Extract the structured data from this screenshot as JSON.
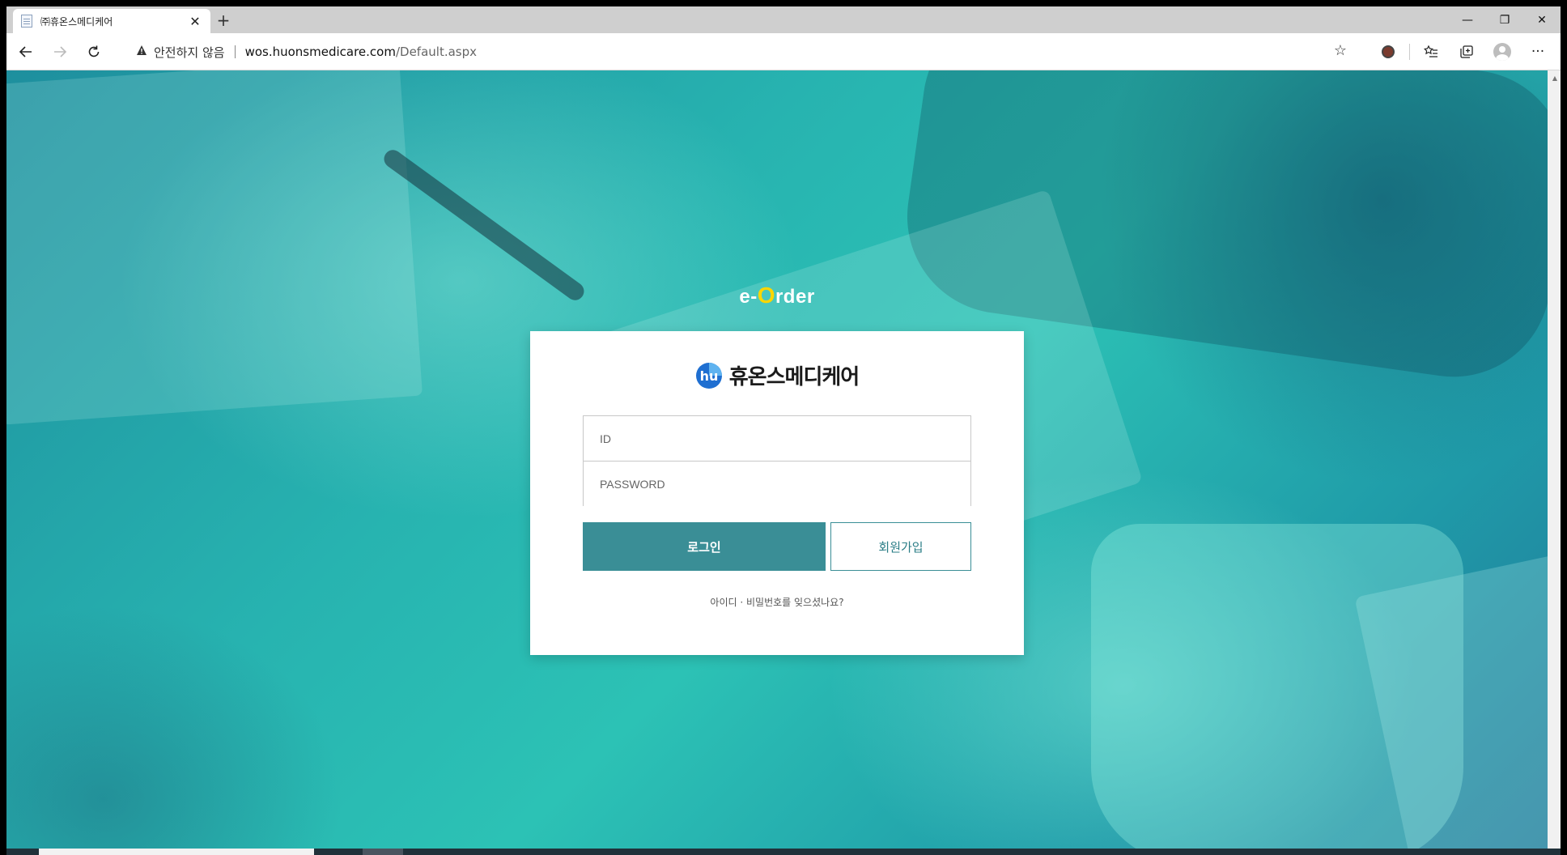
{
  "browser": {
    "tab_title": "㈜휴온스메디케어",
    "new_tab_symbol": "+",
    "close_tab_symbol": "✕",
    "security_warning": "안전하지 않음",
    "url_host": "wos.huonsmedicare.com",
    "url_path": "/Default.aspx",
    "window_controls": {
      "minimize": "—",
      "restore": "❐",
      "close": "✕"
    },
    "icons": [
      "back-arrow-icon",
      "forward-arrow-icon",
      "refresh-icon",
      "warning-icon",
      "favorite-star-icon",
      "extension-icon",
      "favorites-list-icon",
      "collections-icon",
      "profile-avatar-icon",
      "more-menu-icon"
    ]
  },
  "page": {
    "brand_prefix": "e-",
    "brand_o": "O",
    "brand_suffix": "rder",
    "company_name": "휴온스메디케어",
    "logo_letters": "hu",
    "id_placeholder": "ID",
    "password_placeholder": "PASSWORD",
    "login_label": "로그인",
    "signup_label": "회원가입",
    "forgot_label": "아이디 · 비밀번호를 잊으셨나요?"
  },
  "colors": {
    "brand_teal": "#3a8e96",
    "brand_o_yellow": "#ffd600",
    "logo_blue": "#1f6fd1"
  }
}
